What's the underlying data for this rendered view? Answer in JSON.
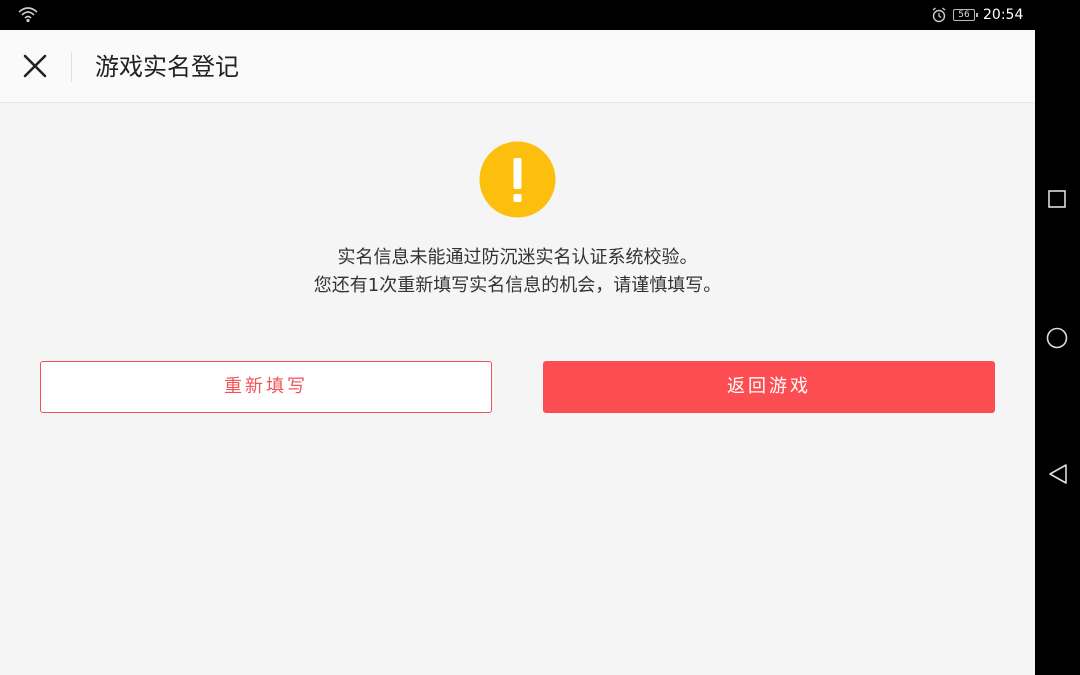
{
  "status_bar": {
    "time": "20:54",
    "battery_level": "56",
    "icons": [
      "wifi-icon",
      "alarm-icon",
      "battery-icon"
    ]
  },
  "nav_bar": {
    "icons": [
      "recent-apps-square-icon",
      "home-circle-icon",
      "back-triangle-icon"
    ]
  },
  "header": {
    "close_icon": "close-icon",
    "title": "游戏实名登记"
  },
  "main": {
    "warning_icon": "exclamation-warning-icon",
    "message_line1": "实名信息未能通过防沉迷实名认证系统校验。",
    "message_line2": "您还有1次重新填写实名信息的机会，请谨慎填写。"
  },
  "actions": {
    "refill_label": "重新填写",
    "return_label": "返回游戏"
  },
  "colors": {
    "accent_red": "#fc4e52",
    "warning_yellow": "#fcbf0e",
    "background": "#f5f5f5"
  }
}
